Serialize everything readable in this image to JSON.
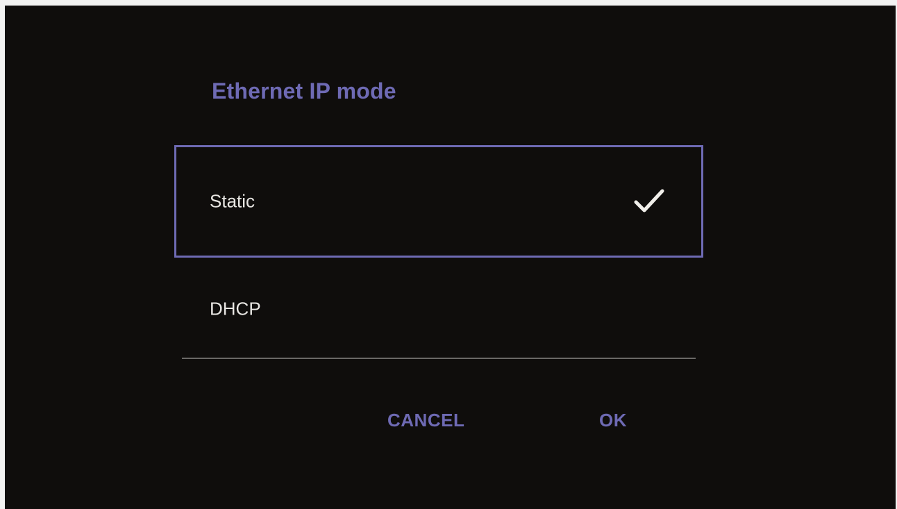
{
  "dialog": {
    "title": "Ethernet IP mode",
    "options": [
      {
        "label": "Static",
        "selected": true
      },
      {
        "label": "DHCP",
        "selected": false
      }
    ],
    "cancel_label": "CANCEL",
    "ok_label": "OK",
    "accent_color": "#6e6ab4",
    "background_color": "#0f0d0c",
    "selected_indicator_icon": "checkmark-icon"
  }
}
